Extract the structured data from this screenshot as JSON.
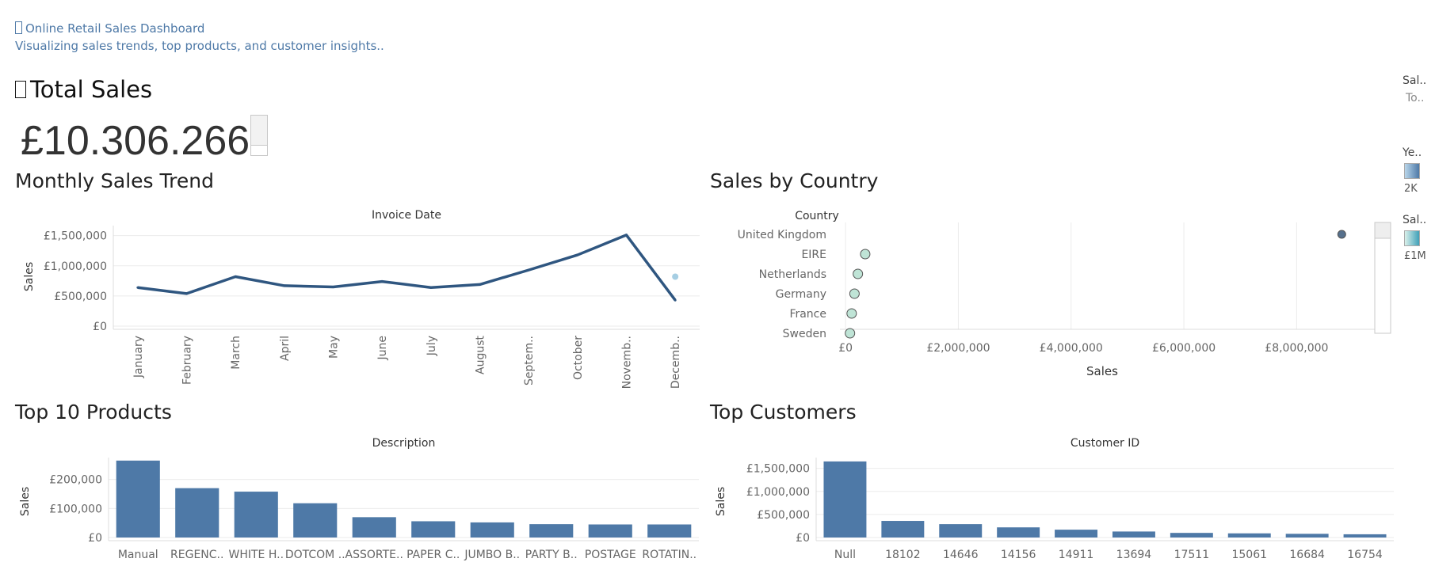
{
  "header": {
    "title": "Online Retail Sales Dashboard",
    "subtitle": "Visualizing sales trends, top products, and customer insights.."
  },
  "kpi": {
    "title": "Total Sales",
    "value": "£10.306.266"
  },
  "legend": {
    "sales_filter_label": "Sal..",
    "sales_filter_value": "To..",
    "year_label": "Ye..",
    "year_range": "2K",
    "sales_color_label": "Sal..",
    "sales_color_range": "£1M"
  },
  "colors": {
    "bar": "#4e79a7",
    "line": "#2f5680",
    "highlight_point": "#a6cee3",
    "grid": "#ebebeb"
  },
  "sections": {
    "monthly": "Monthly Sales Trend",
    "country": "Sales by Country",
    "products": "Top 10 Products",
    "customers": "Top Customers"
  },
  "chart_data": [
    {
      "id": "monthly",
      "type": "line",
      "title": "Invoice Date",
      "xlabel": "",
      "ylabel": "Sales",
      "categories": [
        "January",
        "February",
        "March",
        "April",
        "May",
        "June",
        "July",
        "August",
        "Septem..",
        "October",
        "Novemb..",
        "Decemb.."
      ],
      "values": [
        640000,
        540000,
        820000,
        670000,
        650000,
        740000,
        640000,
        690000,
        930000,
        1180000,
        1510000,
        430000
      ],
      "extra_point": {
        "category": "Decemb..",
        "value": 820000
      },
      "yticks": [
        0,
        500000,
        1000000,
        1500000
      ],
      "ytick_labels": [
        "£0",
        "£500,000",
        "£1,000,000",
        "£1,500,000"
      ],
      "ylim": [
        0,
        1640000
      ]
    },
    {
      "id": "country",
      "type": "scatter",
      "title": "Country",
      "xlabel": "Sales",
      "categories": [
        "United Kingdom",
        "EIRE",
        "Netherlands",
        "Germany",
        "France",
        "Sweden"
      ],
      "values": [
        8800000,
        250000,
        120000,
        60000,
        10000,
        -20000
      ],
      "xticks": [
        0,
        2000000,
        4000000,
        6000000,
        8000000
      ],
      "xtick_labels": [
        "£0",
        "£2,000,000",
        "£4,000,000",
        "£6,000,000",
        "£8,000,000"
      ],
      "xlim": [
        -100000,
        9400000
      ]
    },
    {
      "id": "products",
      "type": "bar",
      "title": "Description",
      "xlabel": "",
      "ylabel": "Sales",
      "categories": [
        "Manual",
        "REGENC..",
        "WHITE H..",
        "DOTCOM ..",
        "ASSORTE..",
        "PAPER C..",
        "JUMBO B..",
        "PARTY B..",
        "POSTAGE",
        "ROTATIN.."
      ],
      "values": [
        265000,
        170000,
        158000,
        118000,
        70000,
        56000,
        52000,
        46000,
        45000,
        45000
      ],
      "yticks": [
        0,
        100000,
        200000
      ],
      "ytick_labels": [
        "£0",
        "£100,000",
        "£200,000"
      ],
      "ylim": [
        0,
        270000
      ]
    },
    {
      "id": "customers",
      "type": "bar",
      "title": "Customer ID",
      "xlabel": "",
      "ylabel": "Sales",
      "categories": [
        "Null",
        "18102",
        "14646",
        "14156",
        "14911",
        "13694",
        "17511",
        "15061",
        "16684",
        "16754"
      ],
      "values": [
        1650000,
        360000,
        290000,
        220000,
        170000,
        130000,
        100000,
        90000,
        80000,
        70000
      ],
      "yticks": [
        0,
        500000,
        1000000,
        1500000
      ],
      "ytick_labels": [
        "£0",
        "£500,000",
        "£1,000,000",
        "£1,500,000"
      ],
      "ylim": [
        0,
        1700000
      ]
    }
  ]
}
